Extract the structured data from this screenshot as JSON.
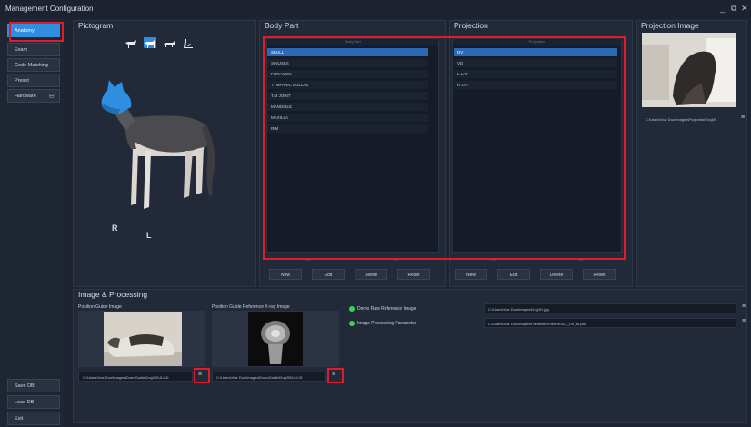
{
  "window": {
    "title": "Management Configuration",
    "controls": [
      "_",
      "⧉",
      "✕"
    ]
  },
  "sidebar": {
    "items": [
      {
        "label": "Anatomy",
        "active": true
      },
      {
        "label": "Exam"
      },
      {
        "label": "Code Matching"
      },
      {
        "label": "Preset"
      },
      {
        "label": "Hardware"
      }
    ],
    "bottom": [
      {
        "label": "Save DB"
      },
      {
        "label": "Load DB"
      },
      {
        "label": "Exit"
      }
    ]
  },
  "pictogram": {
    "title": "Pictogram",
    "labels": {
      "right": "R",
      "left": "L"
    }
  },
  "body_part": {
    "title": "Body Part",
    "header": "Body Part",
    "items": [
      "SKULL",
      "SINUSES",
      "FORAMEN",
      "TYMPANIC BULLAE",
      "T.M JOINT",
      "MANDIBLE",
      "MAXILLA",
      "RIM"
    ],
    "buttons": [
      "New",
      "Edit",
      "Delete",
      "Reset"
    ]
  },
  "projection": {
    "title": "Projection",
    "header": "Projection",
    "items": [
      "DV",
      "VD",
      "L LAT",
      "R LAT"
    ],
    "buttons": [
      "New",
      "Edit",
      "Delete",
      "Reset"
    ]
  },
  "projection_image": {
    "title": "Projection Image",
    "path": "C:\\Users\\Vue Duo\\Images\\Projection\\Dog\\S"
  },
  "image_processing": {
    "title": "Image & Processing",
    "position_guide": {
      "label": "Position Guide Image",
      "path": "C:\\Users\\Vue Duo\\Images\\ExamGuide\\Dog\\SKULL\\D"
    },
    "reference_xray": {
      "label": "Position Guide Reference X-ray Image",
      "path": "C:\\Users\\Vue Duo\\Images\\ExamGuide\\Dog\\SKULL\\D"
    },
    "demo_raw": {
      "label": "Demo Raw Reference Image",
      "path": "C:\\Users\\Vue Duo\\Images\\Dog\\01.jpg"
    },
    "processing_param": {
      "label": "Image Processing Parameter",
      "path": "C:\\Users\\Vue Duo\\Images\\Parameter\\Vet\\SKULL_DV_M.par"
    }
  },
  "colors": {
    "accent": "#2f8ee0",
    "highlight": "#e21b2c",
    "status_ok": "#3bd34a"
  }
}
